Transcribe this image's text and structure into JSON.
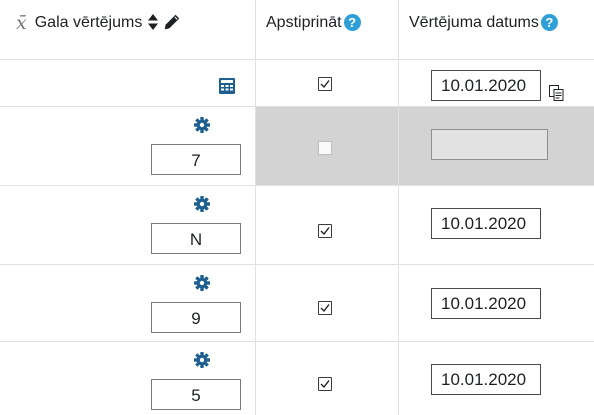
{
  "header": {
    "grade_column_label": "Gala vērtējums",
    "approved_column_label": "Apstiprināt",
    "date_column_label": "Vērtējuma datums",
    "help_glyph": "?",
    "icons": [
      "x-bar-icon",
      "sort-icon",
      "pencil-icon",
      "help-icon"
    ]
  },
  "rows": [
    {
      "grade_icon": "calculator-icon",
      "grade": null,
      "approved": true,
      "date": "10.01.2020",
      "date_icon": "copy-icon",
      "disabled": false
    },
    {
      "grade_icon": "gear-icon",
      "grade": "7",
      "approved": false,
      "date": "",
      "disabled": true
    },
    {
      "grade_icon": "gear-icon",
      "grade": "N",
      "approved": true,
      "date": "10.01.2020",
      "disabled": false
    },
    {
      "grade_icon": "gear-icon",
      "grade": "9",
      "approved": true,
      "date": "10.01.2020",
      "disabled": false
    },
    {
      "grade_icon": "gear-icon",
      "grade": "5",
      "approved": true,
      "date": "10.01.2020",
      "disabled": false
    }
  ],
  "colors": {
    "help_icon": "#2f9fd8",
    "gear_icon": "#1e5f8f",
    "calculator_icon": "#1e5f8f",
    "disabled_row": "#d3d3d3",
    "border": "#dee2e6"
  }
}
